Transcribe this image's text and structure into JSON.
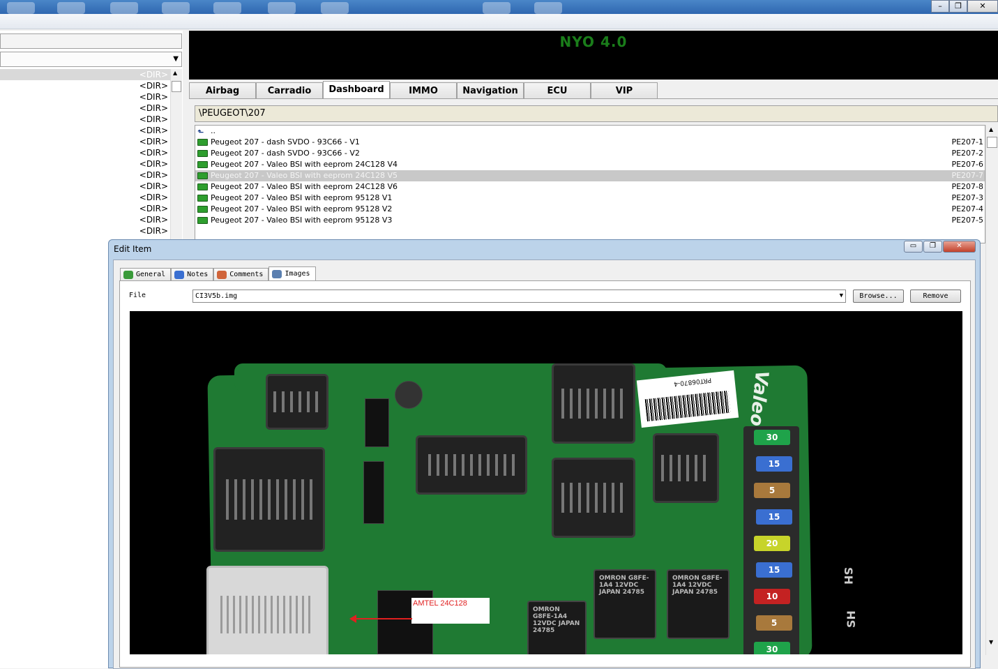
{
  "window": {
    "controls": [
      "–",
      "❐",
      "✕"
    ]
  },
  "left_panel": {
    "dir_entries": [
      "<DIR>",
      "<DIR>",
      "<DIR>",
      "<DIR>",
      "<DIR>",
      "<DIR>",
      "<DIR>",
      "<DIR>",
      "<DIR>",
      "<DIR>",
      "<DIR>",
      "<DIR>",
      "<DIR>",
      "<DIR>",
      "<DIR>"
    ],
    "selected_index": 0
  },
  "banner": {
    "title": "NYO 4.0",
    "title_color": "#1a7d1a"
  },
  "main_tabs": {
    "items": [
      "Airbag",
      "Carradio",
      "Dashboard",
      "IMMO",
      "Navigation",
      "ECU",
      "VIP"
    ],
    "active": "Dashboard"
  },
  "path": "\\PEUGEOT\\207",
  "file_list": {
    "parent": "..",
    "rows": [
      {
        "name": "Peugeot 207 - dash SVDO - 93C66 - V1",
        "code": "PE207-1"
      },
      {
        "name": "Peugeot 207 - dash SVDO - 93C66 - V2",
        "code": "PE207-2"
      },
      {
        "name": "Peugeot 207 - Valeo BSI with eeprom 24C128  V4",
        "code": "PE207-6"
      },
      {
        "name": "Peugeot 207 - Valeo BSI with eeprom 24C128  V5",
        "code": "PE207-7"
      },
      {
        "name": "Peugeot 207 - Valeo BSI with eeprom 24C128  V6",
        "code": "PE207-8"
      },
      {
        "name": "Peugeot 207 - Valeo BSI with eeprom 95128  V1",
        "code": "PE207-3"
      },
      {
        "name": "Peugeot 207 - Valeo BSI with eeprom 95128  V2",
        "code": "PE207-4"
      },
      {
        "name": "Peugeot 207 - Valeo BSI with eeprom 95128  V3",
        "code": "PE207-5"
      }
    ],
    "selected_index": 3
  },
  "dialog": {
    "title": "Edit Item",
    "controls": [
      "▭",
      "❐",
      "✕"
    ],
    "tabs": [
      {
        "label": "General",
        "icon": "general-icon"
      },
      {
        "label": "Notes",
        "icon": "notes-icon"
      },
      {
        "label": "Comments",
        "icon": "comments-icon"
      },
      {
        "label": "Images",
        "icon": "images-icon"
      }
    ],
    "active_tab": "Images",
    "file_label": "File",
    "file_value": "CI3V5b.img",
    "browse_label": "Browse...",
    "remove_label": "Remove"
  },
  "image": {
    "annotation": "AMTEL 24C128",
    "annotation_color": "#e02020",
    "board_brand": "Valeo",
    "label_code": "PRT06870-4",
    "fuses": [
      {
        "text": "30",
        "color": "#1fa34a"
      },
      {
        "text": "15",
        "color": "#3a6fd1"
      },
      {
        "text": "5",
        "color": "#a8793c"
      },
      {
        "text": "15",
        "color": "#3a6fd1"
      },
      {
        "text": "20",
        "color": "#c7d42a"
      },
      {
        "text": "15",
        "color": "#3a6fd1"
      },
      {
        "text": "10",
        "color": "#c42222"
      },
      {
        "text": "5",
        "color": "#a8793c"
      },
      {
        "text": "30",
        "color": "#1fa34a"
      }
    ],
    "relays": [
      {
        "text": "OMRON G8FE-1A4 12VDC JAPAN 24785"
      },
      {
        "text": "OMRON G8FE-1A4 12VDC JAPAN 24785"
      },
      {
        "text": "OMRON G8FE-1A4 12VDC JAPAN 24785"
      }
    ],
    "side_marks": [
      "SH",
      "SH"
    ]
  }
}
